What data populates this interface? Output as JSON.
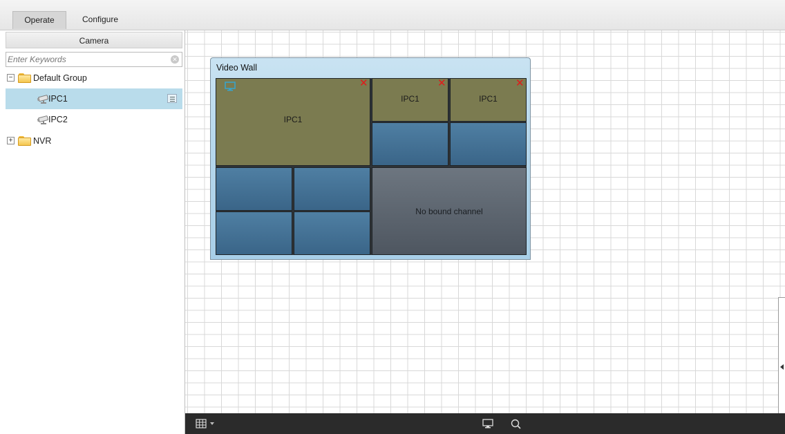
{
  "tabs": [
    {
      "label": "Operate",
      "active": true
    },
    {
      "label": "Configure",
      "active": false
    }
  ],
  "sidebar": {
    "header": "Camera",
    "search": {
      "placeholder": "Enter Keywords",
      "value": ""
    },
    "tree": [
      {
        "label": "Default Group",
        "type": "folder",
        "expanded": true
      },
      {
        "label": "IPC1",
        "type": "camera",
        "selected": true
      },
      {
        "label": "IPC2",
        "type": "camera",
        "selected": false
      },
      {
        "label": "NVR",
        "type": "folder",
        "expanded": false
      }
    ]
  },
  "video_wall": {
    "title": "Video Wall",
    "screens": [
      {
        "label": "IPC1",
        "state": "bound"
      },
      {
        "label": "IPC1",
        "state": "bound"
      },
      {
        "label": "IPC1",
        "state": "bound"
      },
      {
        "label": "",
        "state": "empty"
      },
      {
        "label": "",
        "state": "empty"
      },
      {
        "label": "",
        "state": "empty"
      },
      {
        "label": "",
        "state": "empty"
      },
      {
        "label": "",
        "state": "empty"
      },
      {
        "label": "",
        "state": "empty"
      },
      {
        "label": "No bound channel",
        "state": "unbound"
      }
    ]
  },
  "toolbar": {
    "icons": [
      "layout-grid-icon",
      "dropdown-arrow-icon",
      "monitor-icon",
      "search-icon"
    ]
  },
  "colors": {
    "selected_row": "#b9dceb",
    "bound_screen": "#7b7b50",
    "empty_screen": "#4a7698",
    "unbound_screen": "#5d6670",
    "close_mark": "#e01b1b",
    "bottom_bar": "#2b2b2b"
  }
}
